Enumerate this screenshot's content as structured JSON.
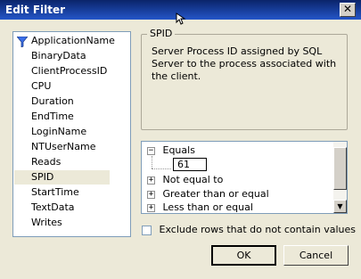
{
  "window": {
    "title": "Edit Filter",
    "close_label": "✕"
  },
  "columns": [
    {
      "label": "ApplicationName",
      "has_filter": true
    },
    {
      "label": "BinaryData"
    },
    {
      "label": "ClientProcessID"
    },
    {
      "label": "CPU"
    },
    {
      "label": "Duration"
    },
    {
      "label": "EndTime"
    },
    {
      "label": "LoginName"
    },
    {
      "label": "NTUserName"
    },
    {
      "label": "Reads"
    },
    {
      "label": "SPID",
      "selected": true
    },
    {
      "label": "StartTime"
    },
    {
      "label": "TextData"
    },
    {
      "label": "Writes"
    }
  ],
  "description": {
    "title": "SPID",
    "text": "Server Process ID assigned by SQL Server to the process associated with the client."
  },
  "operators": [
    {
      "expander": "−",
      "label": "Equals",
      "value": "61"
    },
    {
      "expander": "+",
      "label": "Not equal to"
    },
    {
      "expander": "+",
      "label": "Greater than or equal"
    },
    {
      "expander": "+",
      "label": "Less than or equal"
    }
  ],
  "exclude_rows_label": "Exclude rows that do not contain values",
  "buttons": {
    "ok": "OK",
    "cancel": "Cancel"
  },
  "colors": {
    "titlebar": "#0a246a",
    "dialog_bg": "#ece9d8",
    "list_border": "#7f9db9"
  }
}
